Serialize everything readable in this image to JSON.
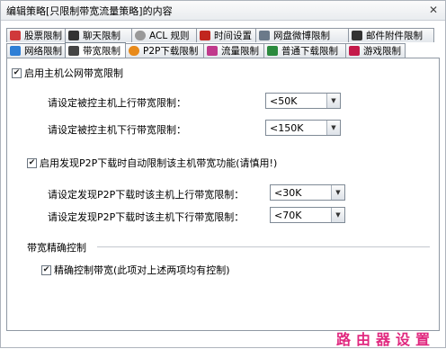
{
  "window": {
    "title": "编辑策略[只限制带宽流量策略]的内容"
  },
  "tabs_row1": [
    {
      "label": "股票限制",
      "icon": "stock-icon",
      "color": "#d0393b"
    },
    {
      "label": "聊天限制",
      "icon": "chat-icon",
      "color": "#333333"
    },
    {
      "label": "ACL 规则",
      "icon": "acl-icon",
      "color": "#888888"
    },
    {
      "label": "时间设置",
      "icon": "clock-icon",
      "color": "#c1261f"
    },
    {
      "label": "网盘微博限制",
      "icon": "netdisk-icon",
      "color": "#6b7a8a"
    },
    {
      "label": "邮件附件限制",
      "icon": "mail-attachment-icon",
      "color": "#333333"
    }
  ],
  "tabs_row2": [
    {
      "label": "网络限制",
      "icon": "network-icon",
      "color": "#2f7fd6"
    },
    {
      "label": "带宽限制",
      "icon": "bandwidth-icon",
      "color": "#444444",
      "active": true
    },
    {
      "label": "P2P下载限制",
      "icon": "p2p-icon",
      "color": "#e88a1a"
    },
    {
      "label": "流量限制",
      "icon": "traffic-icon",
      "color": "#c0398c"
    },
    {
      "label": "普通下载限制",
      "icon": "download-icon",
      "color": "#2b8a3e"
    },
    {
      "label": "游戏限制",
      "icon": "game-icon",
      "color": "#c41a4a"
    }
  ],
  "bandwidth": {
    "enable_host_limit": {
      "label": "启用主机公网带宽限制",
      "checked": true
    },
    "upload_label": "请设定被控主机上行带宽限制：",
    "upload_value": "<50K",
    "download_label": "请设定被控主机下行带宽限制：",
    "download_value": "<150K",
    "enable_p2p_auto": {
      "label": "启用发现P2P下载时自动限制该主机带宽功能(请慎用!)",
      "checked": true
    },
    "p2p_upload_label": "请设定发现P2P下载时该主机上行带宽限制：",
    "p2p_upload_value": "<30K",
    "p2p_download_label": "请设定发现P2P下载时该主机下行带宽限制：",
    "p2p_download_value": "<70K",
    "precise_section_title": "带宽精确控制",
    "precise_control": {
      "label": "精确控制带宽(此项对上述两项均有控制)",
      "checked": true
    }
  },
  "watermark": "路由器设置"
}
